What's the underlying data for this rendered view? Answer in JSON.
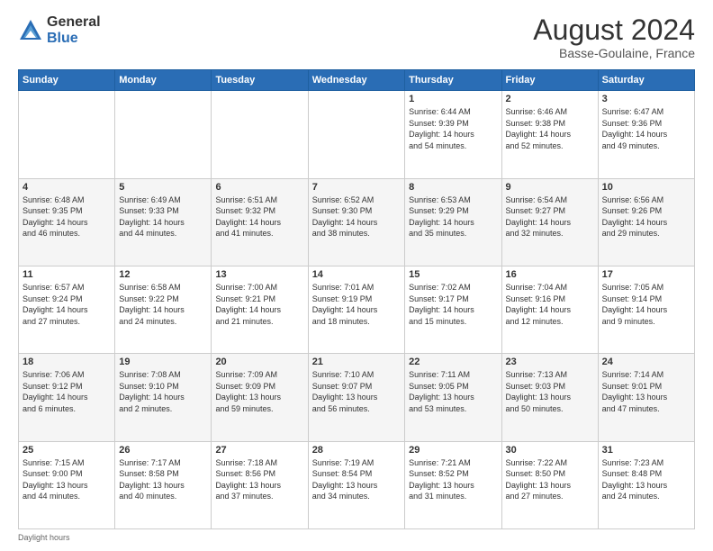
{
  "logo": {
    "general": "General",
    "blue": "Blue"
  },
  "title": {
    "month_year": "August 2024",
    "location": "Basse-Goulaine, France"
  },
  "days_header": [
    "Sunday",
    "Monday",
    "Tuesday",
    "Wednesday",
    "Thursday",
    "Friday",
    "Saturday"
  ],
  "weeks": [
    [
      {
        "day": "",
        "info": ""
      },
      {
        "day": "",
        "info": ""
      },
      {
        "day": "",
        "info": ""
      },
      {
        "day": "",
        "info": ""
      },
      {
        "day": "1",
        "info": "Sunrise: 6:44 AM\nSunset: 9:39 PM\nDaylight: 14 hours\nand 54 minutes."
      },
      {
        "day": "2",
        "info": "Sunrise: 6:46 AM\nSunset: 9:38 PM\nDaylight: 14 hours\nand 52 minutes."
      },
      {
        "day": "3",
        "info": "Sunrise: 6:47 AM\nSunset: 9:36 PM\nDaylight: 14 hours\nand 49 minutes."
      }
    ],
    [
      {
        "day": "4",
        "info": "Sunrise: 6:48 AM\nSunset: 9:35 PM\nDaylight: 14 hours\nand 46 minutes."
      },
      {
        "day": "5",
        "info": "Sunrise: 6:49 AM\nSunset: 9:33 PM\nDaylight: 14 hours\nand 44 minutes."
      },
      {
        "day": "6",
        "info": "Sunrise: 6:51 AM\nSunset: 9:32 PM\nDaylight: 14 hours\nand 41 minutes."
      },
      {
        "day": "7",
        "info": "Sunrise: 6:52 AM\nSunset: 9:30 PM\nDaylight: 14 hours\nand 38 minutes."
      },
      {
        "day": "8",
        "info": "Sunrise: 6:53 AM\nSunset: 9:29 PM\nDaylight: 14 hours\nand 35 minutes."
      },
      {
        "day": "9",
        "info": "Sunrise: 6:54 AM\nSunset: 9:27 PM\nDaylight: 14 hours\nand 32 minutes."
      },
      {
        "day": "10",
        "info": "Sunrise: 6:56 AM\nSunset: 9:26 PM\nDaylight: 14 hours\nand 29 minutes."
      }
    ],
    [
      {
        "day": "11",
        "info": "Sunrise: 6:57 AM\nSunset: 9:24 PM\nDaylight: 14 hours\nand 27 minutes."
      },
      {
        "day": "12",
        "info": "Sunrise: 6:58 AM\nSunset: 9:22 PM\nDaylight: 14 hours\nand 24 minutes."
      },
      {
        "day": "13",
        "info": "Sunrise: 7:00 AM\nSunset: 9:21 PM\nDaylight: 14 hours\nand 21 minutes."
      },
      {
        "day": "14",
        "info": "Sunrise: 7:01 AM\nSunset: 9:19 PM\nDaylight: 14 hours\nand 18 minutes."
      },
      {
        "day": "15",
        "info": "Sunrise: 7:02 AM\nSunset: 9:17 PM\nDaylight: 14 hours\nand 15 minutes."
      },
      {
        "day": "16",
        "info": "Sunrise: 7:04 AM\nSunset: 9:16 PM\nDaylight: 14 hours\nand 12 minutes."
      },
      {
        "day": "17",
        "info": "Sunrise: 7:05 AM\nSunset: 9:14 PM\nDaylight: 14 hours\nand 9 minutes."
      }
    ],
    [
      {
        "day": "18",
        "info": "Sunrise: 7:06 AM\nSunset: 9:12 PM\nDaylight: 14 hours\nand 6 minutes."
      },
      {
        "day": "19",
        "info": "Sunrise: 7:08 AM\nSunset: 9:10 PM\nDaylight: 14 hours\nand 2 minutes."
      },
      {
        "day": "20",
        "info": "Sunrise: 7:09 AM\nSunset: 9:09 PM\nDaylight: 13 hours\nand 59 minutes."
      },
      {
        "day": "21",
        "info": "Sunrise: 7:10 AM\nSunset: 9:07 PM\nDaylight: 13 hours\nand 56 minutes."
      },
      {
        "day": "22",
        "info": "Sunrise: 7:11 AM\nSunset: 9:05 PM\nDaylight: 13 hours\nand 53 minutes."
      },
      {
        "day": "23",
        "info": "Sunrise: 7:13 AM\nSunset: 9:03 PM\nDaylight: 13 hours\nand 50 minutes."
      },
      {
        "day": "24",
        "info": "Sunrise: 7:14 AM\nSunset: 9:01 PM\nDaylight: 13 hours\nand 47 minutes."
      }
    ],
    [
      {
        "day": "25",
        "info": "Sunrise: 7:15 AM\nSunset: 9:00 PM\nDaylight: 13 hours\nand 44 minutes."
      },
      {
        "day": "26",
        "info": "Sunrise: 7:17 AM\nSunset: 8:58 PM\nDaylight: 13 hours\nand 40 minutes."
      },
      {
        "day": "27",
        "info": "Sunrise: 7:18 AM\nSunset: 8:56 PM\nDaylight: 13 hours\nand 37 minutes."
      },
      {
        "day": "28",
        "info": "Sunrise: 7:19 AM\nSunset: 8:54 PM\nDaylight: 13 hours\nand 34 minutes."
      },
      {
        "day": "29",
        "info": "Sunrise: 7:21 AM\nSunset: 8:52 PM\nDaylight: 13 hours\nand 31 minutes."
      },
      {
        "day": "30",
        "info": "Sunrise: 7:22 AM\nSunset: 8:50 PM\nDaylight: 13 hours\nand 27 minutes."
      },
      {
        "day": "31",
        "info": "Sunrise: 7:23 AM\nSunset: 8:48 PM\nDaylight: 13 hours\nand 24 minutes."
      }
    ]
  ],
  "footer": {
    "note": "Daylight hours"
  }
}
